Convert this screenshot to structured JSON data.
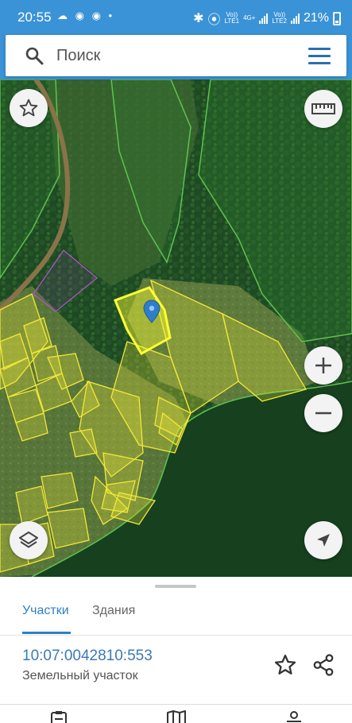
{
  "status_bar": {
    "time": "20:55",
    "left_icons": "☁ ◉ ◉ •",
    "sim1": "Vo))\nLTE1",
    "net": "4G+",
    "sim2": "Vo))\nLTE2",
    "battery": "21%"
  },
  "search": {
    "placeholder": "Поиск"
  },
  "tabs": [
    {
      "label": "Участки",
      "active": true
    },
    {
      "label": "Здания",
      "active": false
    }
  ],
  "parcel": {
    "number": "10:07:0042810:553",
    "type": "Земельный участок"
  },
  "icons": {
    "search": "search-icon",
    "menu": "menu-icon",
    "favorite": "star-icon",
    "ruler": "ruler-icon",
    "zoom_in": "plus-icon",
    "zoom_out": "minus-icon",
    "layers": "layers-icon",
    "locate": "navigation-arrow-icon",
    "share": "share-icon",
    "marker": "location-pin-icon"
  },
  "colors": {
    "accent": "#3a93d6",
    "link": "#2e7fc1",
    "parcel_outline": "#f2e838",
    "selected_parcel": "#ffff33",
    "marker": "#2f7ecb"
  }
}
